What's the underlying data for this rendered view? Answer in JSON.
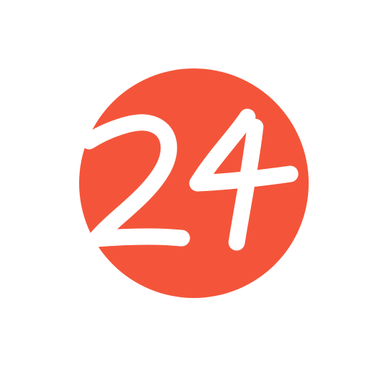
{
  "logo": {
    "text": "24",
    "circle_color": "#F4553A",
    "glyph_color": "#FFFFFF",
    "background_color": "#FFFFFF"
  }
}
